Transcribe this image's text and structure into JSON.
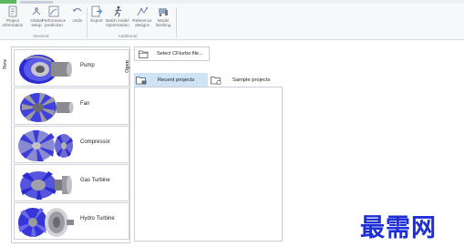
{
  "ribbon": {
    "buttons": [
      {
        "label": "Project\ninformation",
        "icon": "project-info-icon"
      },
      {
        "label": "Global\nsetup",
        "icon": "global-setup-icon"
      },
      {
        "label": "Performance\nprediction",
        "icon": "performance-icon"
      },
      {
        "label": "Undo",
        "icon": "undo-icon"
      },
      {
        "label": "Export",
        "icon": "export-icon"
      },
      {
        "label": "Batch mode/\nOptimization",
        "icon": "batch-mode-icon"
      },
      {
        "label": "Reference\ndesigns",
        "icon": "reference-designs-icon"
      },
      {
        "label": "Model\nfinishing",
        "icon": "model-finishing-icon"
      }
    ],
    "groups": {
      "general": "General",
      "additional": "Additional"
    }
  },
  "new_section": {
    "label": "New",
    "tiles": [
      {
        "name": "Pump",
        "icon": "pump-icon"
      },
      {
        "name": "Fan",
        "icon": "fan-icon"
      },
      {
        "name": "Compressor",
        "icon": "compressor-icon"
      },
      {
        "name": "Gas Turbine",
        "icon": "gas-turbine-icon"
      },
      {
        "name": "Hydro Turbine",
        "icon": "hydro-turbine-icon"
      }
    ]
  },
  "open_section": {
    "label": "Open",
    "select_button": "Select CFturbo file...",
    "tabs": [
      {
        "label": "Recent projects",
        "active": true
      },
      {
        "label": "Sample projects",
        "active": false
      }
    ]
  },
  "watermark": "最需网",
  "colors": {
    "accent_green": "#5cb85c",
    "tab_active": "#cfe3f7",
    "impeller_blue": "#3f3fe0",
    "watermark_blue": "#1d2ed8"
  }
}
